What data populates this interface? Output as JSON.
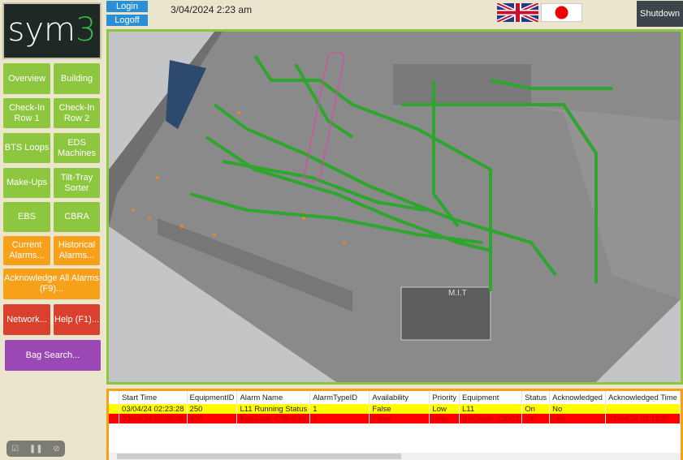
{
  "logo": {
    "text": "sym",
    "accent": "3"
  },
  "top": {
    "login": "Login",
    "logoff": "Logoff",
    "datetime": "3/04/2024 2:23 am",
    "shutdown": "Shutdown",
    "flags": [
      "uk-flag",
      "japan-flag"
    ]
  },
  "nav": [
    {
      "label": "Overview",
      "color": "green"
    },
    {
      "label": "Building",
      "color": "green"
    },
    {
      "label": "Check-In Row 1",
      "color": "green"
    },
    {
      "label": "Check-In Row 2",
      "color": "green"
    },
    {
      "label": "BTS Loops",
      "color": "green"
    },
    {
      "label": "EDS Machines",
      "color": "green"
    },
    {
      "label": "Make-Ups",
      "color": "green"
    },
    {
      "label": "Tilt-Tray Sorter",
      "color": "green"
    },
    {
      "label": "EBS",
      "color": "green"
    },
    {
      "label": "CBRA",
      "color": "green"
    },
    {
      "label": "Current Alarms...",
      "color": "orange"
    },
    {
      "label": "Historical Alarms...",
      "color": "orange"
    },
    {
      "label": "Acknowledge All Alarms (F9)...",
      "color": "orange"
    },
    {
      "label": "Network...",
      "color": "red"
    },
    {
      "label": "Help (F1)...",
      "color": "red"
    },
    {
      "label": "Bag Search...",
      "color": "purple"
    }
  ],
  "view": {
    "mit_label": "M.I.T"
  },
  "alarms": {
    "columns": [
      "Start Time",
      "EquipmentID",
      "Alarm Name",
      "AlarmTypeID",
      "Availability",
      "Priority",
      "Equipment",
      "Status",
      "Acknowledged",
      "Acknowledged Time"
    ],
    "rows": [
      [
        "03/04/24 02:23:28",
        "250",
        "L11 Running Status",
        "1",
        "False",
        "Low",
        "L11",
        "On",
        "No",
        ""
      ],
      [
        "03/04/24 02:00:28",
        "405",
        "BagGate_CIB02 Int",
        "6",
        "False",
        "High",
        "BAGgate_CIB02",
        "On",
        "Yes",
        "03/04/24 02:11:37"
      ]
    ]
  },
  "colors": {
    "green": "#8dc63f",
    "orange": "#f7a11a",
    "red": "#d9402e",
    "purple": "#9a48b4"
  }
}
